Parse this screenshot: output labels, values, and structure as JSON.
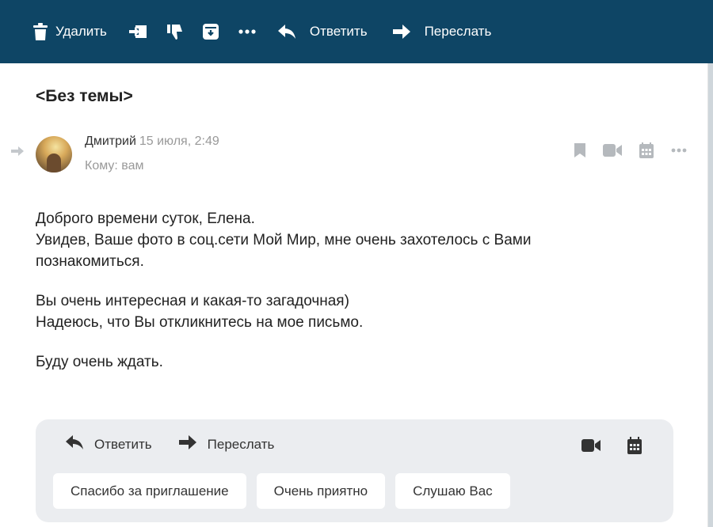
{
  "toolbar": {
    "delete_label": "Удалить",
    "reply_label": "Ответить",
    "forward_label": "Переслать",
    "icons": [
      "trash-icon",
      "move-to-folder-icon",
      "dislike-icon",
      "archive-icon",
      "more-icon",
      "reply-icon",
      "forward-icon"
    ]
  },
  "message": {
    "subject": "<Без темы>",
    "sender_name": "Дмитрий",
    "date": "15 июля, 2:49",
    "to_line": "Кому: вам",
    "body": {
      "line1": "Доброго времени суток, Елена.",
      "line2": "Увидев, Ваше фото в соц.сети Мой Мир, мне очень захотелось с Вами",
      "line3": "познакомиться.",
      "line4": "Вы очень интересная и какая-то загадочная)",
      "line5": "Надеюсь, что Вы откликнитесь на мое письмо.",
      "line6": "Буду очень ждать."
    }
  },
  "quick_reply": {
    "reply_label": "Ответить",
    "forward_label": "Переслать",
    "suggestions": [
      "Спасибо за приглашение",
      "Очень приятно",
      "Слушаю Вас"
    ]
  },
  "colors": {
    "header": "#0e4565",
    "panel": "#ffffff",
    "quick_bg": "#ebedf0",
    "icon_gray": "#b5b9bd",
    "text": "#222222"
  }
}
